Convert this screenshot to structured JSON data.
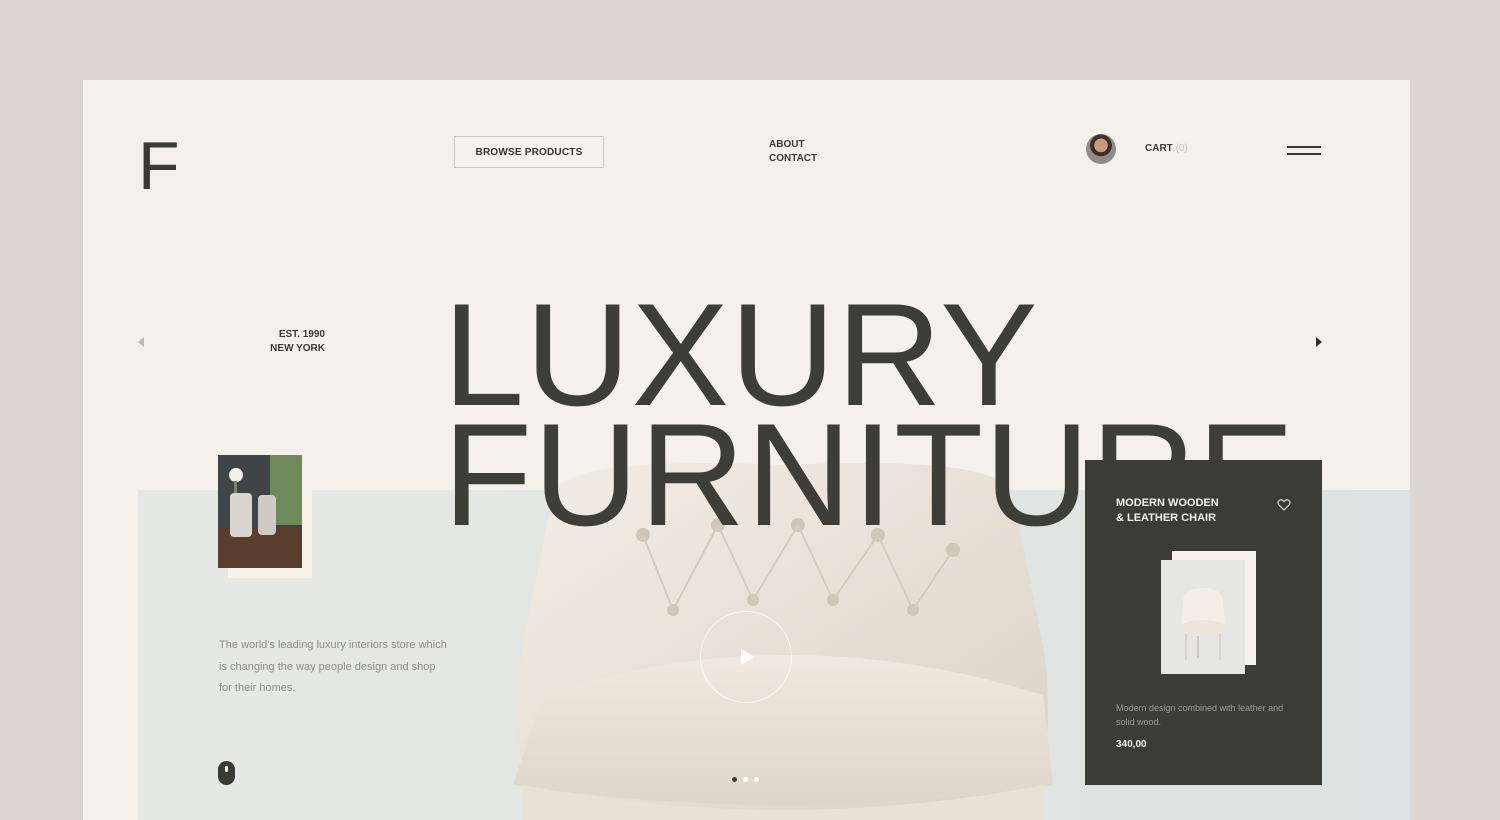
{
  "header": {
    "logo": "F",
    "browse_label": "BROWSE PRODUCTS",
    "nav": [
      "ABOUT",
      "CONTACT"
    ],
    "cart_label": "CART",
    "cart_count": "(0)"
  },
  "hero": {
    "est_line1": "EST. 1990",
    "est_line2": "NEW YORK",
    "headline_line1": "LUXURY",
    "headline_line2": "FURNITURE",
    "description": "The world's leading luxury interiors store which is changing the way people design and shop for their homes.",
    "slide_dots": {
      "count": 3,
      "active": 1
    }
  },
  "product_card": {
    "title_line1": "MODERN WOODEN",
    "title_line2": "& LEATHER CHAIR",
    "description": "Modern design combined with leather and solid wood.",
    "price": "340,00"
  },
  "colors": {
    "background": "#dbd6d0",
    "frame": "#f4f1eb",
    "text_dark": "#3a3a35",
    "card_bg": "#3c3c36",
    "hero_band": "#e2e6e3"
  },
  "icons": [
    "hamburger-menu-icon",
    "arrow-left-icon",
    "arrow-right-icon",
    "heart-icon",
    "play-icon",
    "mouse-scroll-icon"
  ]
}
